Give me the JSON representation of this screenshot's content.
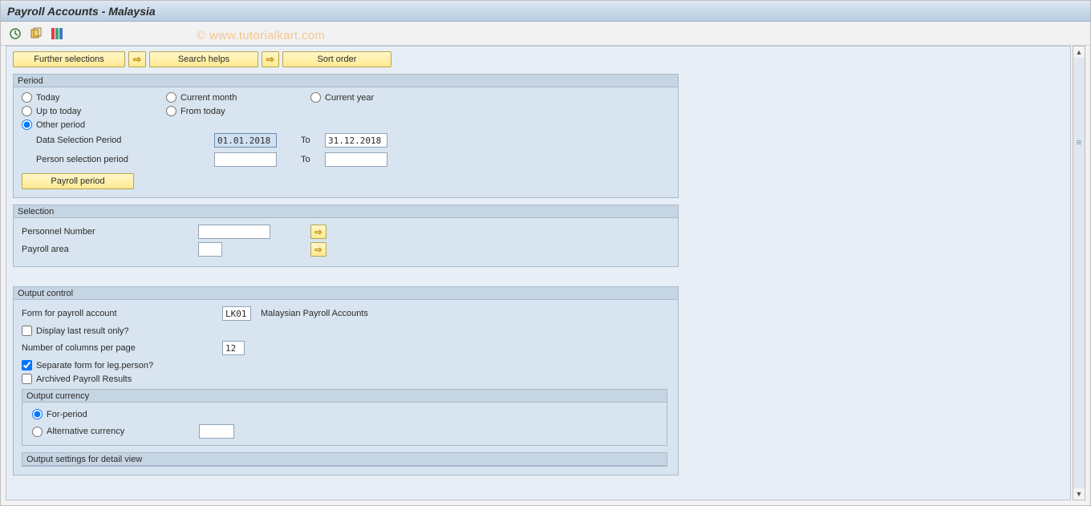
{
  "title": "Payroll Accounts - Malaysia",
  "watermark": "© www.tutorialkart.com",
  "btnbar": {
    "further_selections": "Further selections",
    "search_helps": "Search helps",
    "sort_order": "Sort order"
  },
  "period": {
    "title": "Period",
    "opts": {
      "today": "Today",
      "up_to_today": "Up to today",
      "other_period": "Other period",
      "current_month": "Current month",
      "from_today": "From today",
      "current_year": "Current year"
    },
    "data_sel_label": "Data Selection Period",
    "data_sel_from": "01.01.2018",
    "to_label": "To",
    "data_sel_to": "31.12.2018",
    "person_sel_label": "Person selection period",
    "person_sel_from": "",
    "person_sel_to": "",
    "payroll_period_btn": "Payroll period"
  },
  "selection": {
    "title": "Selection",
    "personnel_number_label": "Personnel Number",
    "personnel_number_value": "",
    "payroll_area_label": "Payroll area",
    "payroll_area_value": ""
  },
  "output": {
    "title": "Output control",
    "form_label": "Form for payroll account",
    "form_value": "LK01",
    "form_desc": "Malaysian Payroll Accounts",
    "display_last_label": "Display last result only?",
    "num_cols_label": "Number of columns per page",
    "num_cols_value": "12",
    "separate_form_label": "Separate form for leg.person?",
    "archived_label": "Archived Payroll Results",
    "currency": {
      "title": "Output currency",
      "for_period": "For-period",
      "alternative": "Alternative currency",
      "alt_value": ""
    },
    "settings_detail_title": "Output settings for detail view"
  }
}
